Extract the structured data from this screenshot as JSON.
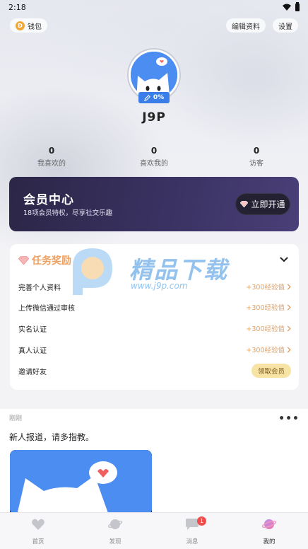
{
  "status_bar": {
    "time": "2:18"
  },
  "header": {
    "wallet_label": "钱包",
    "coin_symbol": "D",
    "edit_label": "编辑资料",
    "settings_label": "设置"
  },
  "profile": {
    "username": "J9P",
    "completion": "0%"
  },
  "stats": [
    {
      "value": "0",
      "label": "我喜欢的"
    },
    {
      "value": "0",
      "label": "喜欢我的"
    },
    {
      "value": "0",
      "label": "访客"
    }
  ],
  "vip": {
    "title": "会员中心",
    "subtitle": "18项会员特权，尽享社交乐趣",
    "button_label": "立即开通"
  },
  "tasks": {
    "title": "任务奖励",
    "items": [
      {
        "name": "完善个人资料",
        "reward": "+300经验值"
      },
      {
        "name": "上传微信通过审核",
        "reward": "+300经验值"
      },
      {
        "name": "实名认证",
        "reward": "+300经验值"
      },
      {
        "name": "真人认证",
        "reward": "+300经验值"
      },
      {
        "name": "邀请好友",
        "action": "领取会员"
      }
    ]
  },
  "watermark": {
    "text": "精品下载",
    "url": "www.j9p.com"
  },
  "feed": {
    "time": "刚刚",
    "more": "•••",
    "text": "新人报道，请多指教。"
  },
  "tabs": [
    {
      "label": "首页",
      "icon": "heart-icon"
    },
    {
      "label": "发现",
      "icon": "planet-icon"
    },
    {
      "label": "消息",
      "icon": "chat-icon",
      "badge": "1"
    },
    {
      "label": "我的",
      "icon": "planet-active-icon"
    }
  ],
  "colors": {
    "accent_blue": "#3b7ee8",
    "vip_bg": "#2c2647",
    "reward_orange": "#e0a165",
    "badge_red": "#f24b4b"
  }
}
